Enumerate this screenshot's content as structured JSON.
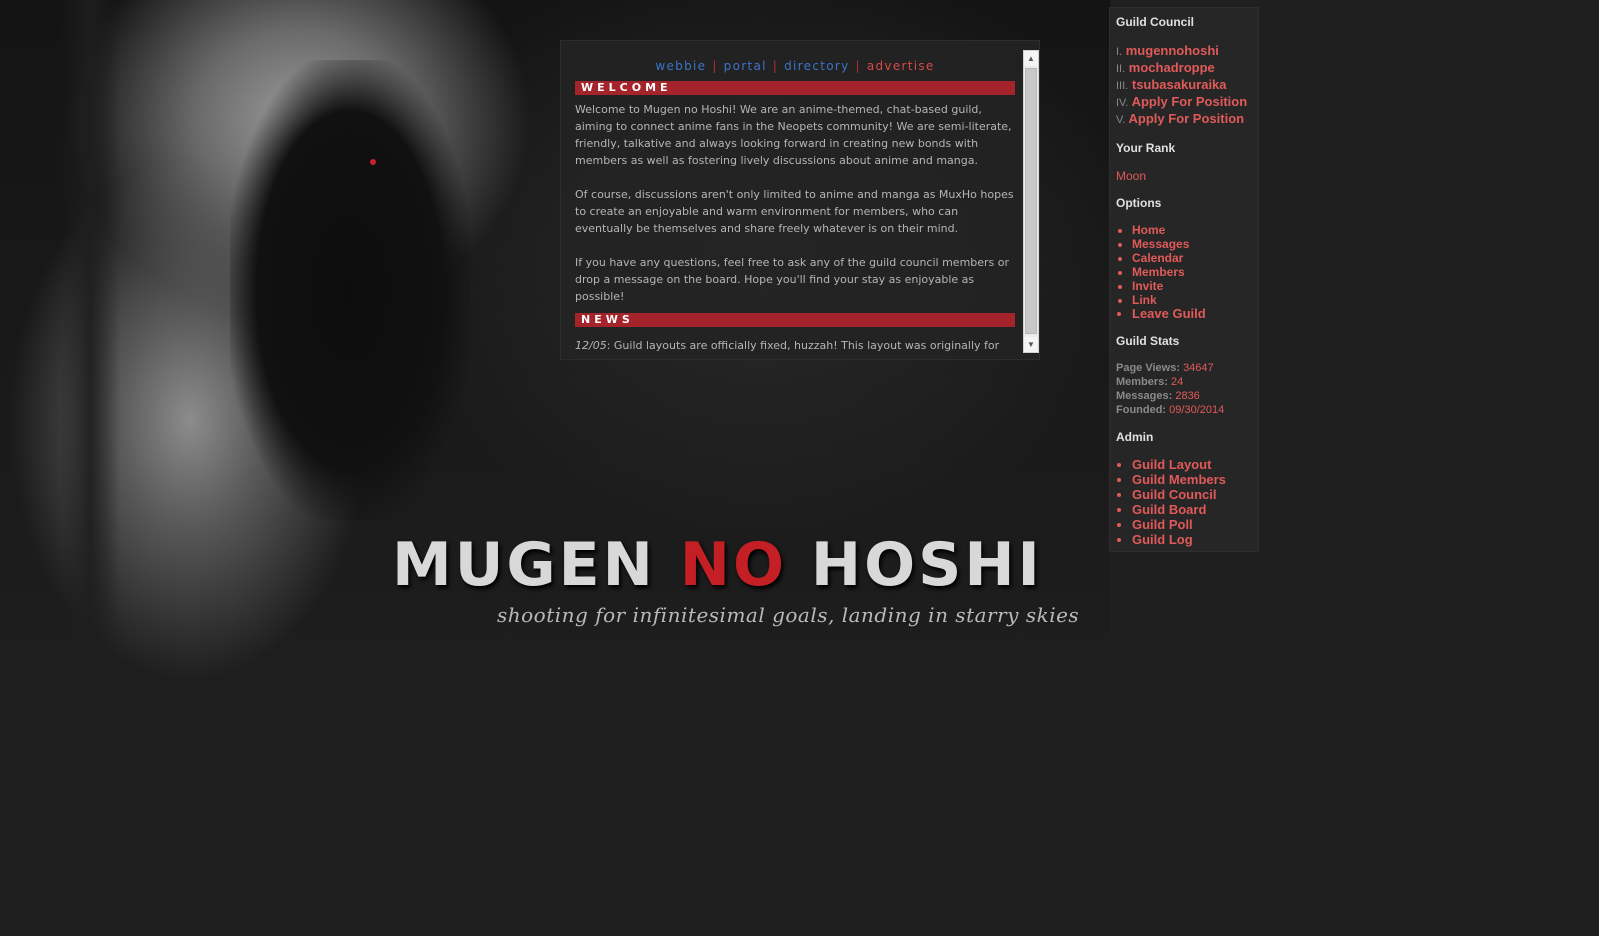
{
  "nav": {
    "links": [
      {
        "label": "webbie",
        "color": "blue"
      },
      {
        "label": "portal",
        "color": "blue"
      },
      {
        "label": "directory",
        "color": "blue"
      },
      {
        "label": "advertise",
        "color": "red"
      }
    ],
    "separator": "|"
  },
  "welcome": {
    "heading": "WELCOME",
    "paragraphs": [
      "Welcome to Mugen no Hoshi! We are an anime-themed, chat-based guild, aiming to connect anime fans in the Neopets community! We are semi-literate, friendly, talkative and always looking forward in creating new bonds with members as well as fostering lively discussions about anime and manga.",
      "Of course, discussions aren't only limited to anime and manga as MuxHo hopes to create an enjoyable and warm environment for members, who can eventually be themselves and share freely whatever is on their mind.",
      "If you have any questions, feel free to ask any of the guild council members or drop a message on the board. Hope you'll find your stay as enjoyable as possible!"
    ]
  },
  "news": {
    "heading": "NEWS",
    "date": "12/05",
    "text": ": Guild layouts are officially fixed, huzzah! This layout was originally for October but it'll remain until next week when the December layout is up."
  },
  "scrollbar": {
    "up_icon": "▲",
    "down_icon": "▼"
  },
  "logo": {
    "part1": "MUGEN ",
    "accent": "NO",
    "part2": " HOSHI",
    "tagline": "shooting for infinitesimal goals, landing in starry skies"
  },
  "sidebar": {
    "council_heading": "Guild Council",
    "council": [
      {
        "num": "I.",
        "name": "mugennohoshi"
      },
      {
        "num": "II.",
        "name": "mochadroppe"
      },
      {
        "num": "III.",
        "name": "tsubasakuraika"
      },
      {
        "num": "IV.",
        "name": "Apply For Position"
      },
      {
        "num": "V.",
        "name": "Apply For Position"
      }
    ],
    "rank_heading": "Your Rank",
    "rank": "Moon",
    "options_heading": "Options",
    "options": [
      "Home",
      "Messages",
      "Calendar",
      "Members",
      "Invite",
      "Link",
      "Leave Guild"
    ],
    "stats_heading": "Guild Stats",
    "stats": [
      {
        "label": "Page Views:",
        "value": "34647"
      },
      {
        "label": "Members:",
        "value": "24"
      },
      {
        "label": "Messages:",
        "value": "2836"
      },
      {
        "label": "Founded:",
        "value": "09/30/2014"
      }
    ],
    "admin_heading": "Admin",
    "admin": [
      "Guild Layout",
      "Guild Members",
      "Guild Council",
      "Guild Board",
      "Guild Poll",
      "Guild Log"
    ]
  },
  "colors": {
    "accent_red": "#a5232b",
    "link_red": "#e05a5a",
    "nav_blue": "#3b73c9"
  }
}
